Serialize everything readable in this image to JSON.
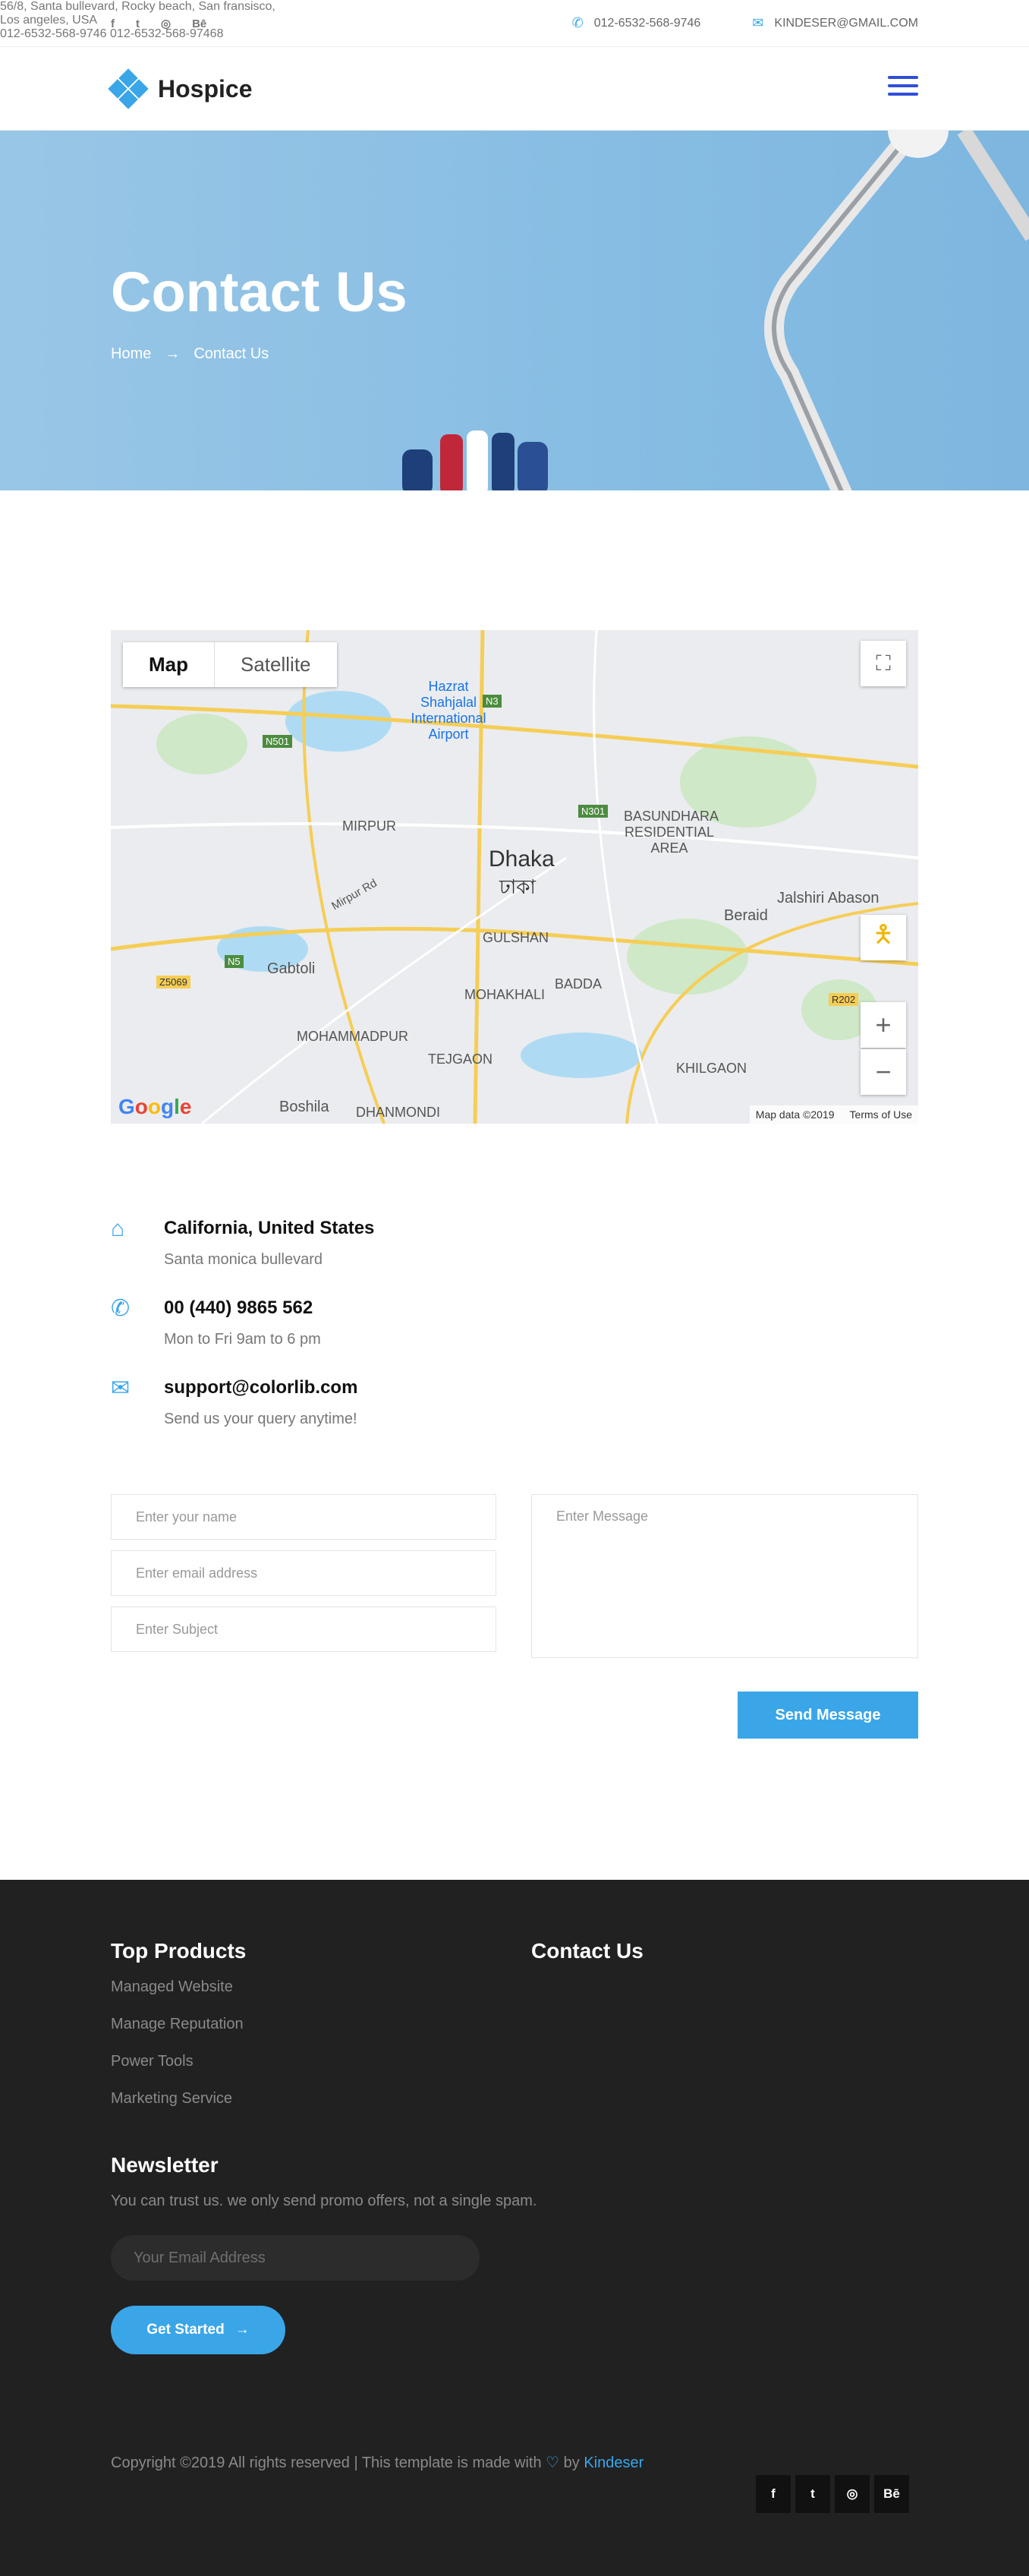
{
  "topbar": {
    "social": [
      "f",
      "t",
      "d",
      "Bē"
    ],
    "phone": "012-6532-568-9746",
    "email": "KINDESER@GMAIL.COM"
  },
  "nav": {
    "logo_text": "Hospice"
  },
  "banner": {
    "title": "Contact Us",
    "crumb_home": "Home",
    "crumb_arrow": "→",
    "crumb_current": "Contact Us"
  },
  "map": {
    "tab_map": "Map",
    "tab_satellite": "Satellite",
    "labels": [
      "Hazrat Shahjalal International Airport",
      "MIRPUR",
      "Dhaka",
      "ঢাকা",
      "GULSHAN",
      "BASUNDHARA RESIDENTIAL AREA",
      "Beraid",
      "Jalshiri Abason",
      "Gabtoli",
      "MOHAMMADPUR",
      "MOHAKHALI",
      "BADDA",
      "TEJGAON",
      "KHILGAON",
      "Boshila",
      "DHANMONDI",
      "Mirpur Rd",
      "N501",
      "N3",
      "N301",
      "N5",
      "Z5069",
      "R202"
    ],
    "google": "Google",
    "data_text": "Map data ©2019",
    "terms": "Terms of Use"
  },
  "contact_info": [
    {
      "title": "California, United States",
      "sub": "Santa monica bullevard",
      "icon": "home-icon"
    },
    {
      "title": "00 (440) 9865 562",
      "sub": "Mon to Fri 9am to 6 pm",
      "icon": "phone-icon"
    },
    {
      "title": "support@colorlib.com",
      "sub": "Send us your query anytime!",
      "icon": "mail-icon"
    }
  ],
  "form": {
    "name_placeholder": "Enter your name",
    "email_placeholder": "Enter email address",
    "subject_placeholder": "Enter Subject",
    "message_placeholder": "Enter Message",
    "send_label": "Send Message"
  },
  "footer": {
    "top_products_title": "Top Products",
    "products": [
      "Managed Website",
      "Manage Reputation",
      "Power Tools",
      "Marketing Service"
    ],
    "contact_title": "Contact Us",
    "address_line1": "56/8, Santa bullevard, Rocky beach, San fransisco,",
    "address_line2": "Los angeles, USA",
    "phone1": "012-6532-568-9746",
    "phone2": "012-6532-568-97468",
    "newsletter_title": "Newsletter",
    "newsletter_text": "You can trust us. we only send promo offers, not a single spam.",
    "email_placeholder": "Your Email Address",
    "cta_label": "Get Started",
    "copyright_pre": "Copyright ©2019 All rights reserved | This template is made with",
    "copyright_by": "by",
    "brand": "Kindeser",
    "social": [
      "f",
      "t",
      "d",
      "Bē"
    ]
  },
  "colors": {
    "accent": "#3aa6e8",
    "footer_bg": "#212122",
    "hamburger": "#2f4fd8"
  }
}
